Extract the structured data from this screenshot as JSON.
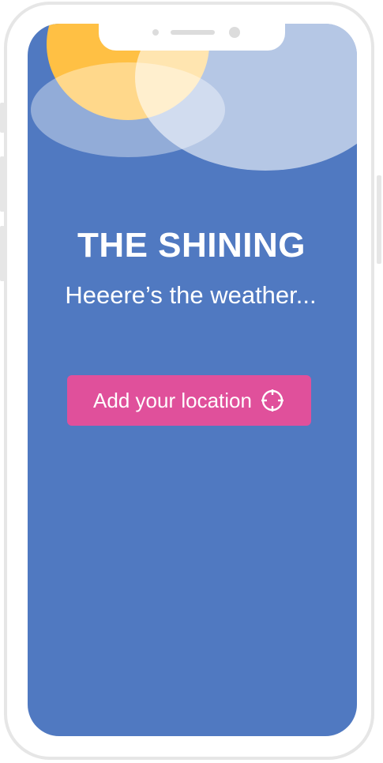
{
  "app": {
    "title": "THE SHINING",
    "subtitle": "Heeere’s the weather..."
  },
  "actions": {
    "add_location_label": "Add your location",
    "add_location_icon": "crosshair-icon"
  },
  "colors": {
    "screen_background": "#5079c1",
    "sun": "#ffc044",
    "button_background": "#e0509b",
    "text": "#ffffff",
    "device_frame": "#e6e6e6"
  }
}
